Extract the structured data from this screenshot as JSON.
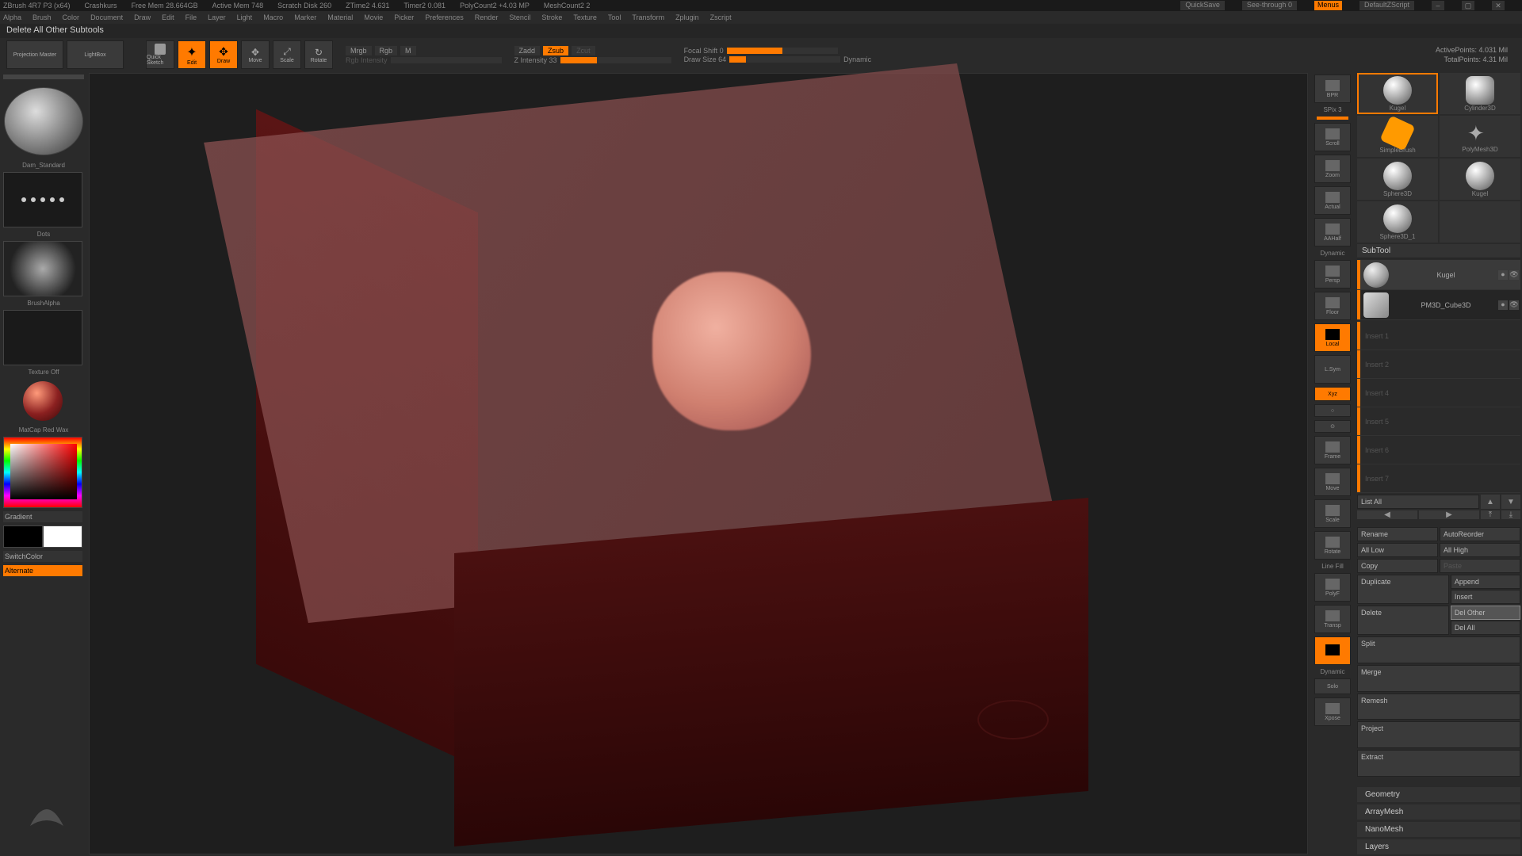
{
  "titlebar": {
    "app": "ZBrush 4R7 P3 (x64)",
    "doc": "Crashkurs",
    "mem": "Free Mem 28.664GB",
    "amem": "Active Mem 748",
    "scratch": "Scratch Disk 260",
    "ztime": "ZTime2 4.631",
    "timer": "Timer2 0.081",
    "polycount": "PolyCount2 +4.03 MP",
    "meshcount": "MeshCount2 2",
    "quicksave": "QuickSave",
    "seethrough": "See-through  0",
    "menus": "Menus",
    "zscript": "DefaultZScript"
  },
  "menus": [
    "Alpha",
    "Brush",
    "Color",
    "Document",
    "Draw",
    "Edit",
    "File",
    "Layer",
    "Light",
    "Macro",
    "Marker",
    "Material",
    "Movie",
    "Picker",
    "Preferences",
    "Render",
    "Stencil",
    "Stroke",
    "Texture",
    "Tool",
    "Transform",
    "Zplugin",
    "Zscript"
  ],
  "hint": "Delete All Other Subtools",
  "toolbar": {
    "projection": "Projection Master",
    "lightbox": "LightBox",
    "quicksketch": "Quick Sketch",
    "edit": "Edit",
    "draw": "Draw",
    "move": "Move",
    "scale": "Scale",
    "rotate": "Rotate",
    "mrgb": "Mrgb",
    "rgb": "Rgb",
    "m": "M",
    "zadd": "Zadd",
    "zsub": "Zsub",
    "zcut": "Zcut",
    "rgbint": "Rgb Intensity",
    "zint": "Z Intensity 33",
    "focal": "Focal Shift 0",
    "drawsize": "Draw Size 64",
    "dynamic": "Dynamic",
    "active": "ActivePoints: 4.031 Mil",
    "total": "TotalPoints: 4.31 Mil"
  },
  "left": {
    "brush": "Dam_Standard",
    "stroke": "Dots",
    "alpha": "BrushAlpha",
    "texture": "Texture Off",
    "material": "MatCap Red Wax",
    "gradient": "Gradient",
    "switch": "SwitchColor",
    "alternate": "Alternate"
  },
  "shelf": {
    "bpr": "BPR",
    "spix": "SPix 3",
    "scroll": "Scroll",
    "zoom": "Zoom",
    "actual": "Actual",
    "aahalf": "AAHalf",
    "persp": "Persp",
    "floor": "Floor",
    "local": "Local",
    "lsym": "L.Sym",
    "xyz": "Xyz",
    "frame": "Frame",
    "movehand": "Move",
    "scale2": "Scale",
    "rotate2": "Rotate",
    "linefill": "Line Fill",
    "polyf": "PolyF",
    "transp": "Transp",
    "dynamic2": "Dynamic",
    "solo": "Solo",
    "xpose": "Xpose"
  },
  "tools": {
    "t0": "Kugel",
    "t1": "Cylinder3D",
    "t2": "SimpleBrush",
    "t3": "PolyMesh3D",
    "t4": "Sphere3D",
    "t5": "Kugel",
    "t6": "Sphere3D_1"
  },
  "subtool": {
    "header": "SubTool",
    "item0": "Kugel",
    "item1": "PM3D_Cube3D",
    "slot1": "Insert 1",
    "slot2": "Insert 2",
    "slot3": "Insert 4",
    "slot4": "Insert 5",
    "slot5": "Insert 6",
    "slot6": "Insert 7",
    "listall": "List All",
    "rename": "Rename",
    "autoreorder": "AutoReorder",
    "alllow": "All Low",
    "allhigh": "All High",
    "copy": "Copy",
    "paste": "Paste",
    "duplicate": "Duplicate",
    "append": "Append",
    "insert": "Insert",
    "delete": "Delete",
    "delother": "Del Other",
    "delall": "Del All",
    "split": "Split",
    "merge": "Merge",
    "remesh": "Remesh",
    "project": "Project",
    "extract": "Extract"
  },
  "sections": {
    "geometry": "Geometry",
    "arraymesh": "ArrayMesh",
    "nanomesh": "NanoMesh",
    "layers": "Layers"
  }
}
